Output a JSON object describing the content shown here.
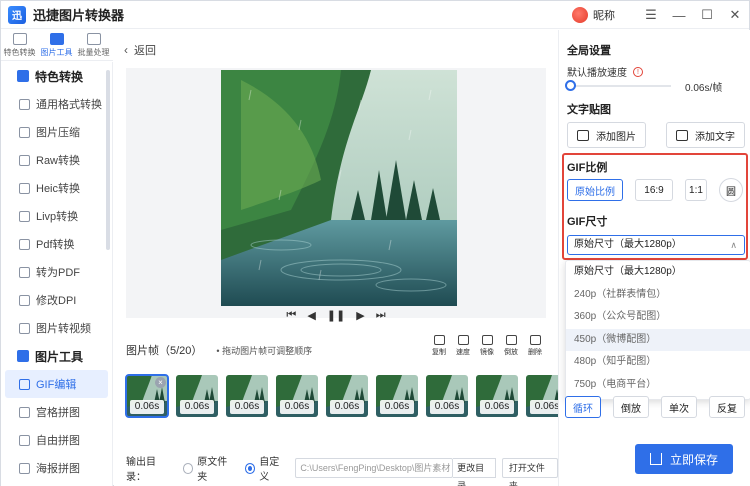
{
  "app": {
    "logo_text": "迅",
    "title": "迅捷图片转换器",
    "nickname": "昵称"
  },
  "window": {
    "menu": "☰",
    "minimize": "—",
    "maximize": "☐",
    "close": "✕"
  },
  "rail": [
    {
      "label": "特色转换"
    },
    {
      "label": "图片工具"
    },
    {
      "label": "批量处理"
    }
  ],
  "sidebar": {
    "group1": "特色转换",
    "items1": [
      "通用格式转换",
      "图片压缩",
      "Raw转换",
      "Heic转换",
      "Livp转换",
      "Pdf转换",
      "转为PDF",
      "修改DPI",
      "图片转视频"
    ],
    "group2": "图片工具",
    "items2": [
      "GIF编辑",
      "宫格拼图",
      "自由拼图",
      "海报拼图"
    ]
  },
  "main": {
    "back_label": "返回",
    "player": {
      "first": "⏮",
      "prev": "◀",
      "pause": "❚❚",
      "next": "▶",
      "last": "⏭"
    },
    "frames_label": "图片帧（5/20）",
    "frames_tip": "•  拖动图片帧可调整顺序",
    "tools": [
      "复制",
      "速度",
      "镜像",
      "倒放",
      "删除"
    ],
    "frames": [
      "0.06s",
      "0.06s",
      "0.06s",
      "0.06s",
      "0.06s",
      "0.06s",
      "0.06s",
      "0.06s",
      "0.06s"
    ],
    "frame_close": "×",
    "output_label": "输出目录：",
    "opt_original": "原文件夹",
    "opt_custom": "自定义",
    "path_value": "C:\\Users\\FengPing\\Desktop\\图片素材",
    "change_dir": "更改目录",
    "open_folder": "打开文件夹"
  },
  "right": {
    "global_title": "全局设置",
    "speed_label": "默认播放速度",
    "speed_hint": "!",
    "speed_value": "0.06s/帧",
    "sticker_title": "文字贴图",
    "add_image": "添加图片",
    "add_text": "添加文字",
    "gif_ratio_title": "GIF比例",
    "ratios": [
      "原始比例",
      "16:9",
      "1:1",
      "圆"
    ],
    "gif_size_title": "GIF尺寸",
    "size_selected": "原始尺寸（最大1280p）",
    "size_options": [
      "原始尺寸（最大1280p）",
      "240p（社群表情包）",
      "360p（公众号配图）",
      "450p（微博配图）",
      "480p（知乎配图）",
      "750p（电商平台）"
    ],
    "modes": [
      "循环",
      "倒放",
      "单次",
      "反复"
    ],
    "save_label": "立即保存"
  },
  "colors": {
    "accent": "#2f6fe8",
    "highlight": "#e2453a"
  }
}
